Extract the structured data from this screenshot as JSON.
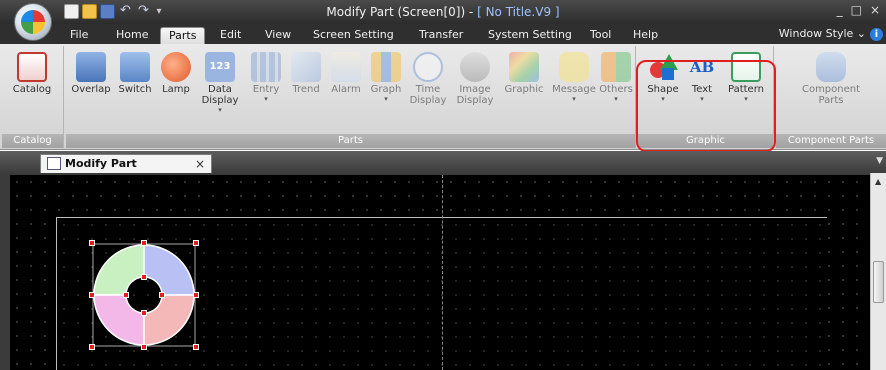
{
  "window": {
    "title_prefix": "Modify Part (Screen[0]) - ",
    "title_doc": "[ No Title.V9 ]",
    "controls": [
      "_",
      "□",
      "×"
    ]
  },
  "quick_access": [
    "new-icon",
    "open-icon",
    "save-icon",
    "undo-icon",
    "redo-icon"
  ],
  "menu_tabs": [
    "File",
    "Home",
    "Parts",
    "Edit",
    "View",
    "Screen Setting",
    "Transfer",
    "System Setting",
    "Tool",
    "Help"
  ],
  "active_tab": "Parts",
  "window_style_label": "Window Style ⌄",
  "ribbon": {
    "catalog_group": {
      "label": "Catalog",
      "buttons": [
        {
          "label": "Catalog",
          "icon": "catalog-icon"
        }
      ]
    },
    "parts_group": {
      "label": "Parts",
      "buttons": [
        {
          "label": "Overlap",
          "sub": "",
          "arrow": "",
          "icon": "overlap-icon"
        },
        {
          "label": "Switch",
          "sub": "",
          "arrow": "",
          "icon": "switch-icon"
        },
        {
          "label": "Lamp",
          "sub": "",
          "arrow": "",
          "icon": "lamp-icon"
        },
        {
          "label": "Data",
          "sub": "Display",
          "arrow": "▾",
          "icon": "data-display-icon"
        },
        {
          "label": "Entry",
          "sub": "",
          "arrow": "▾",
          "icon": "entry-icon"
        },
        {
          "label": "Trend",
          "sub": "",
          "arrow": "",
          "icon": "trend-icon"
        },
        {
          "label": "Alarm",
          "sub": "",
          "arrow": "",
          "icon": "alarm-icon"
        },
        {
          "label": "Graph",
          "sub": "",
          "arrow": "▾",
          "icon": "graph-icon"
        },
        {
          "label": "Time",
          "sub": "Display",
          "arrow": "▾",
          "icon": "time-display-icon"
        },
        {
          "label": "Image",
          "sub": "Display",
          "arrow": "▾",
          "icon": "image-display-icon"
        },
        {
          "label": "Graphic",
          "sub": "",
          "arrow": "",
          "icon": "graphic-icon"
        },
        {
          "label": "Message",
          "sub": "",
          "arrow": "▾",
          "icon": "message-icon"
        },
        {
          "label": "Others",
          "sub": "",
          "arrow": "▾",
          "icon": "others-icon"
        }
      ]
    },
    "graphic_group": {
      "label": "Graphic",
      "buttons": [
        {
          "label": "Shape",
          "arrow": "▾",
          "icon": "shape-icon"
        },
        {
          "label": "Text",
          "arrow": "▾",
          "icon": "text-icon",
          "glyph": "AB"
        },
        {
          "label": "Pattern",
          "arrow": "▾",
          "icon": "pattern-icon"
        }
      ]
    },
    "component_group": {
      "label": "Component Parts",
      "buttons": [
        {
          "label": "Component",
          "sub": "Parts",
          "icon": "component-parts-icon"
        }
      ]
    }
  },
  "document_tab": {
    "label": "Modify Part (Screen[0])",
    "close": "×"
  },
  "part": {
    "name": "donut-part",
    "segment_colors": [
      "#c8f0c0",
      "#b8c0f4",
      "#f4b8e8",
      "#f4b8b8"
    ]
  }
}
